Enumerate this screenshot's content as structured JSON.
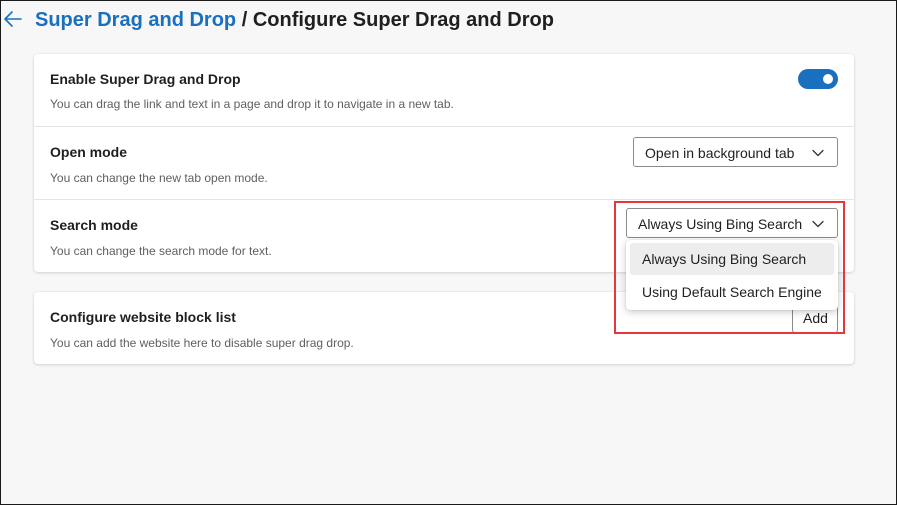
{
  "header": {
    "parent": "Super Drag and Drop",
    "separator": " / ",
    "current": "Configure Super Drag and Drop",
    "back_icon": "arrow-left-icon"
  },
  "settings": {
    "enable": {
      "title": "Enable Super Drag and Drop",
      "description": "You can drag the link and text in a page and drop it to navigate in a new tab.",
      "toggle_on": true
    },
    "open_mode": {
      "title": "Open mode",
      "description": "You can change the new tab open mode.",
      "selected": "Open in background tab"
    },
    "search_mode": {
      "title": "Search mode",
      "description": "You can change the search mode for text.",
      "selected": "Always Using Bing Search",
      "options": [
        "Always Using Bing Search",
        "Using Default Search Engine"
      ]
    }
  },
  "block_list": {
    "title": "Configure website block list",
    "description": "You can add the website here to disable super drag drop.",
    "add_label": "Add"
  },
  "colors": {
    "accent": "#1a6fbf",
    "highlight": "#e5383b"
  }
}
